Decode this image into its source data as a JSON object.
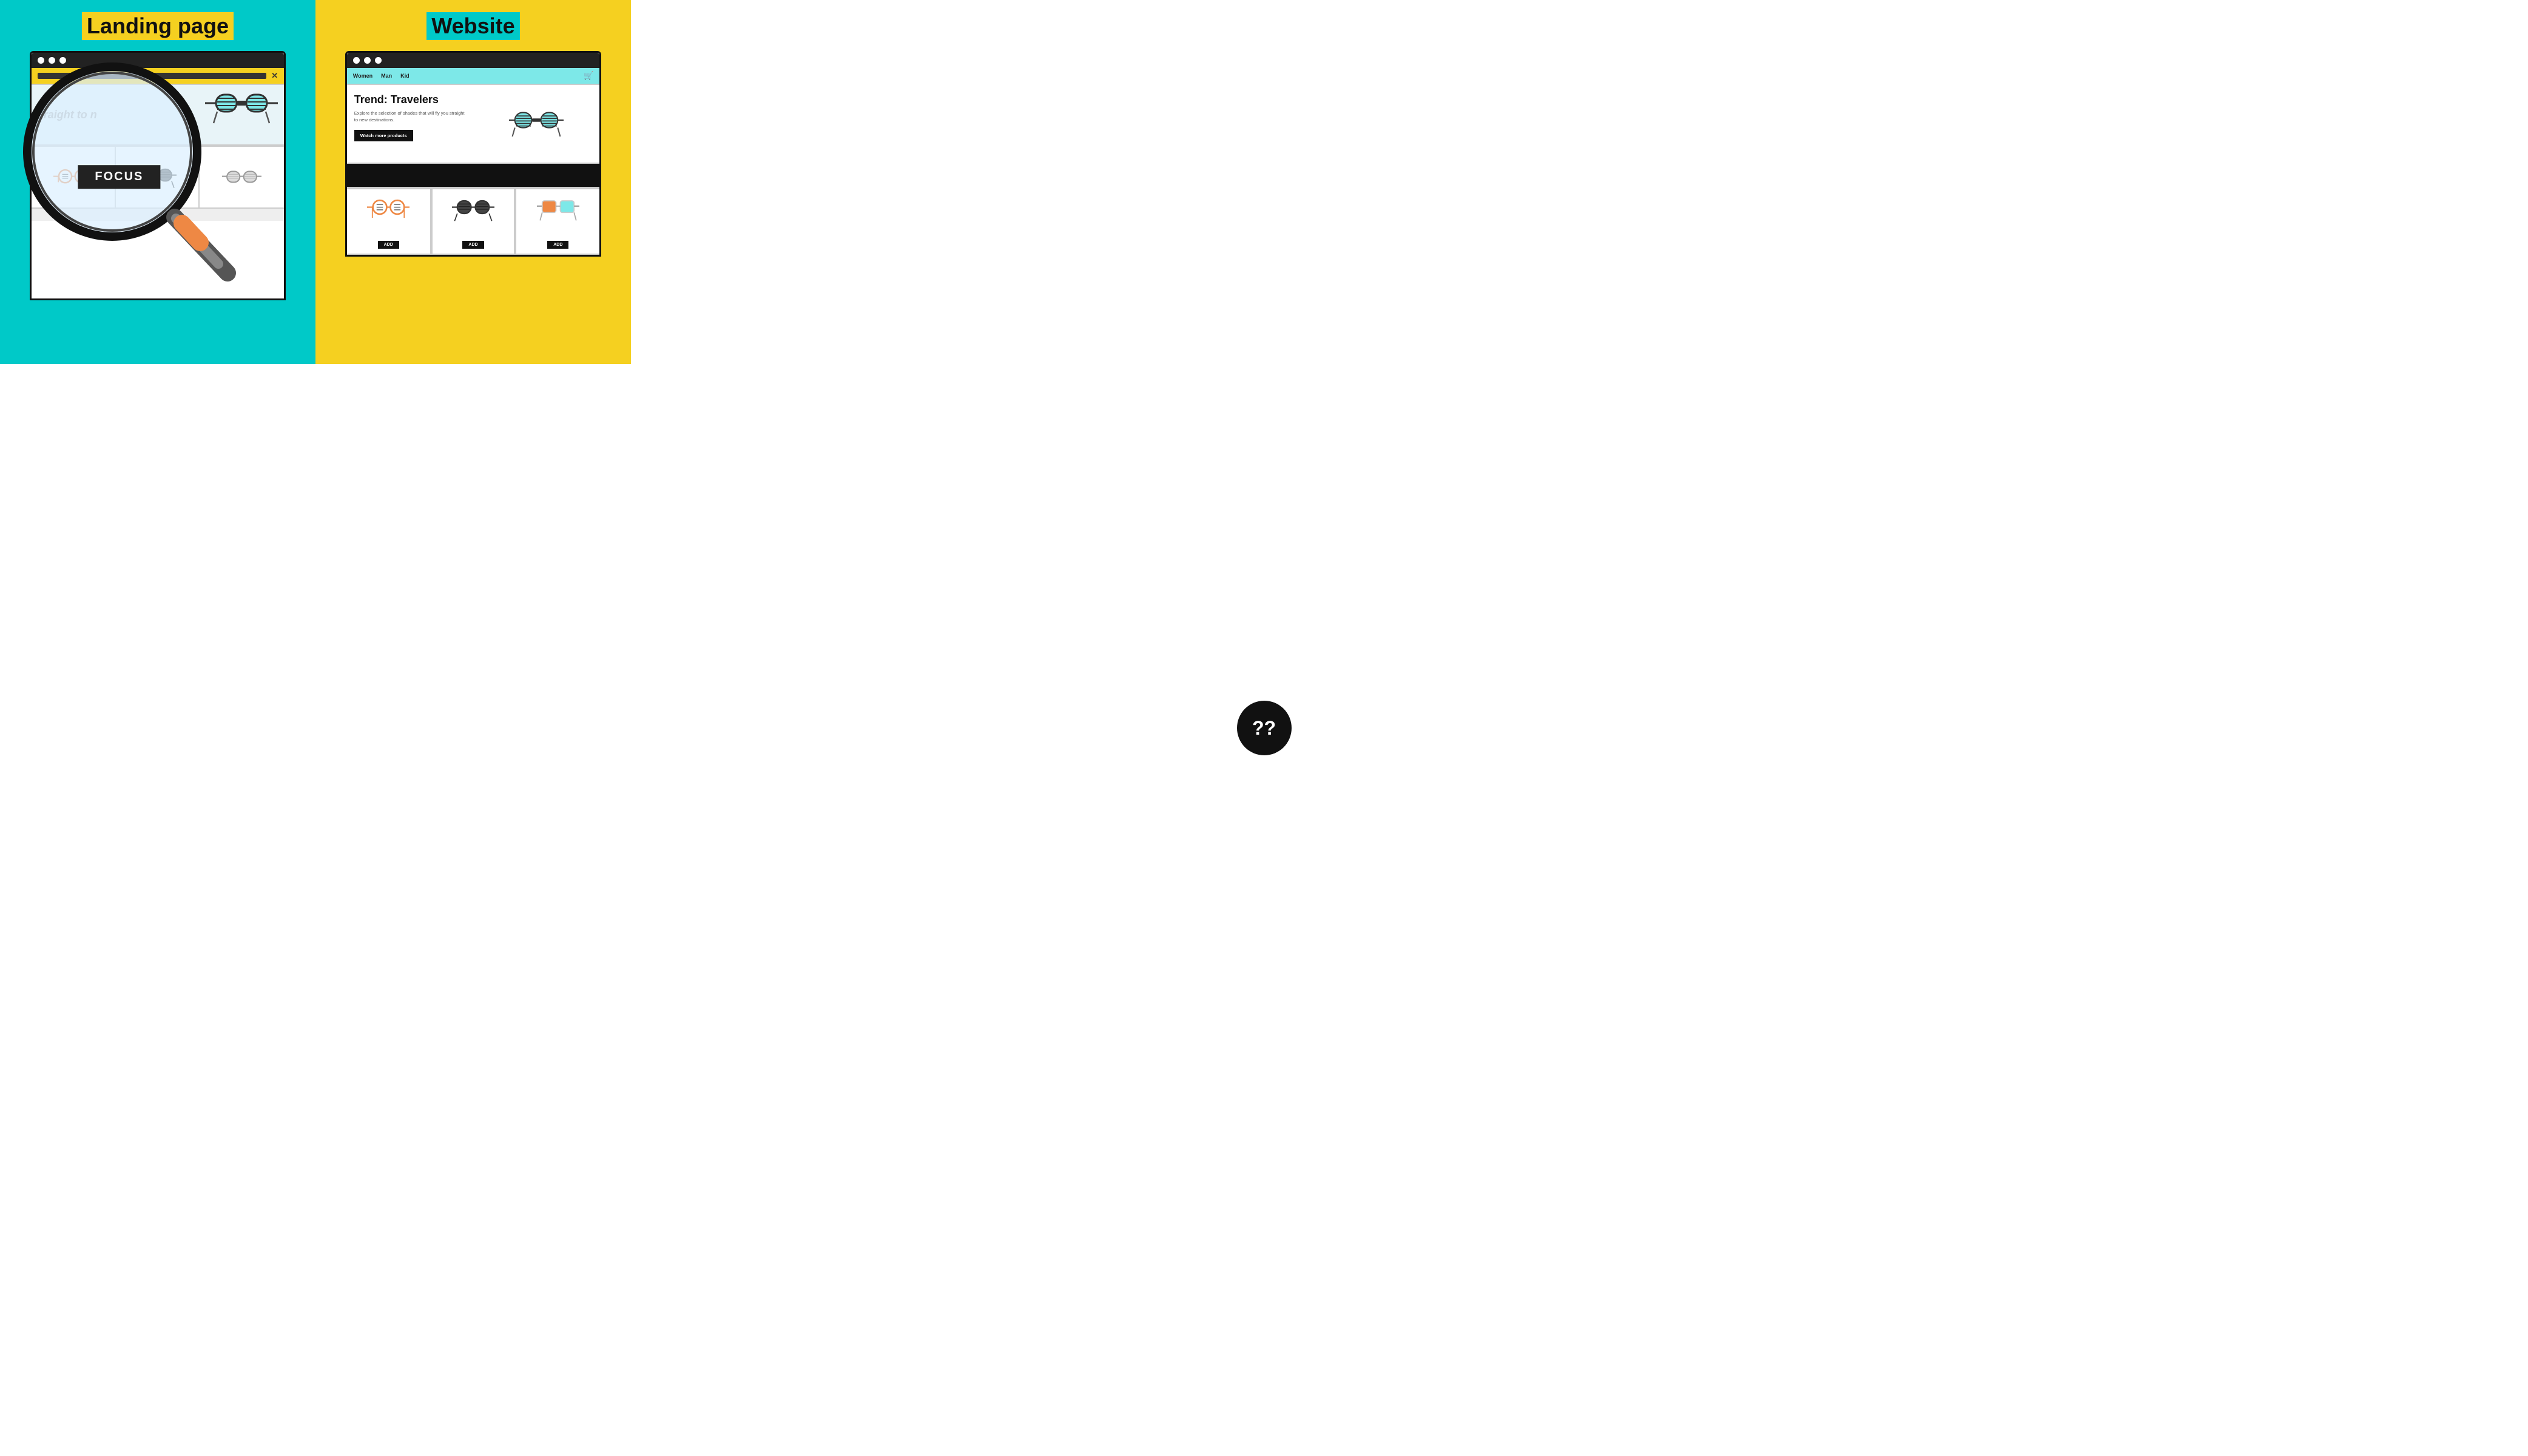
{
  "left": {
    "title": "Landing page",
    "highlight_bg": "#F5D020",
    "panel_bg": "#00C9C8",
    "hero_text": "traight to n",
    "focus_label": "FOCUS",
    "browser_dots": [
      "●",
      "●",
      "●"
    ]
  },
  "right": {
    "title": "Website",
    "highlight_bg": "#00C9C8",
    "panel_bg": "#F5D020",
    "nav_links": [
      "Women",
      "Man",
      "Kid"
    ],
    "hero_title": "Trend: Travelers",
    "hero_subtitle": "Explore the selection of shades that will fly you\nstraight to new destinations.",
    "watch_more_btn": "Watch more products",
    "add_btn": "ADD",
    "browser_dots": [
      "●",
      "●",
      "●"
    ]
  },
  "center": {
    "question_marks": "??"
  }
}
